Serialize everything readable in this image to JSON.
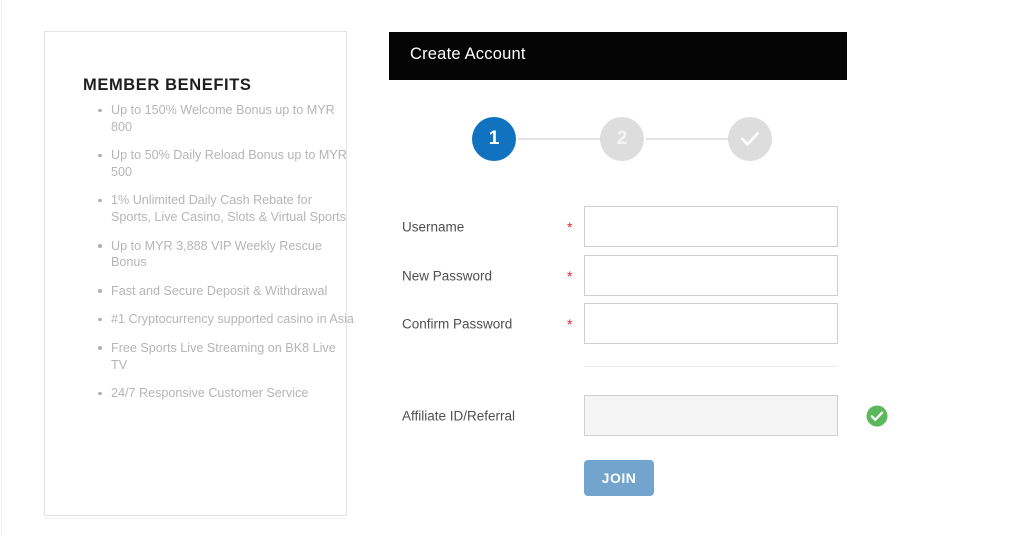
{
  "benefits_panel": {
    "title": "MEMBER BENEFITS",
    "items": [
      "Up to 150% Welcome Bonus up to MYR 800",
      "Up to 50% Daily Reload Bonus up to MYR 500",
      "1% Unlimited Daily Cash Rebate for Sports, Live Casino, Slots & Virtual Sports",
      "Up to MYR 3,888 VIP Weekly Rescue Bonus",
      "Fast and Secure Deposit & Withdrawal",
      "#1 Cryptocurrency supported casino in Asia",
      "Free Sports Live Streaming on BK8 Live TV",
      "24/7 Responsive Customer Service"
    ]
  },
  "account_panel": {
    "header_title": "Create Account",
    "header_bg": "#050505",
    "steps": [
      {
        "label": "1",
        "state": "active",
        "color": "#1173bf"
      },
      {
        "label": "2",
        "state": "inactive",
        "color": "#dddddd"
      },
      {
        "label": "check",
        "state": "inactive",
        "color": "#dddddd",
        "icon": "check-icon"
      }
    ],
    "fields": [
      {
        "label": "Username",
        "required": "*",
        "value": "",
        "placeholder": "",
        "readonly": false
      },
      {
        "label": "New Password",
        "required": "*",
        "value": "",
        "placeholder": "",
        "readonly": false
      },
      {
        "label": "Confirm Password",
        "required": "*",
        "value": "",
        "placeholder": "",
        "readonly": false
      },
      {
        "label": "Affiliate ID/Referral",
        "required": "",
        "value": "",
        "placeholder": "",
        "readonly": true
      }
    ],
    "validation_icon": "green-check-circle-icon",
    "validation_color": "#5cb85c",
    "submit_label": "JOIN",
    "submit_color": "#72a4ce"
  }
}
